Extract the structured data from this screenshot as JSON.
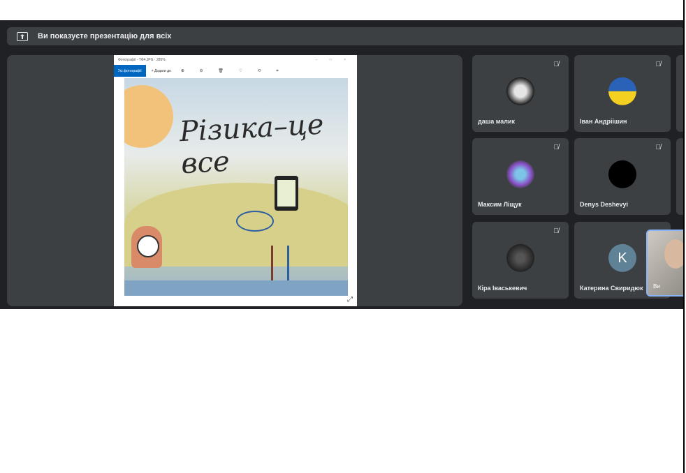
{
  "banner": {
    "text": "Ви показуєте презентацію для всіх",
    "icon": "present-screen-icon"
  },
  "photos_window": {
    "title": "Фотографії - ТФ4.JPG · 285%",
    "window_controls": "– □ ×",
    "all_photos_label": "Усі фотографії",
    "add_to_label": "+ Додати до",
    "tools_glyphs": "⊕ ⊖ 🗑 ♡ ⟲ ⌗",
    "image_title": "Різика–це все"
  },
  "participants": [
    {
      "name": "даша малик",
      "avatar": "photo"
    },
    {
      "name": "Іван Андріішин",
      "avatar": "ukraine-flag"
    },
    {
      "name": "Максим Ліщук",
      "avatar": "cartoon"
    },
    {
      "name": "Denys Deshevyi",
      "avatar": "black"
    },
    {
      "name": "Кіра Іваськевич",
      "avatar": "photo"
    },
    {
      "name": "Катерина Свиридюк",
      "avatar": "initial",
      "initial": "K"
    }
  ],
  "self_view": {
    "label": "Ви"
  },
  "colors": {
    "meet_background": "#202124",
    "tile_background": "#3c4043",
    "accent": "#8ab4f8"
  }
}
